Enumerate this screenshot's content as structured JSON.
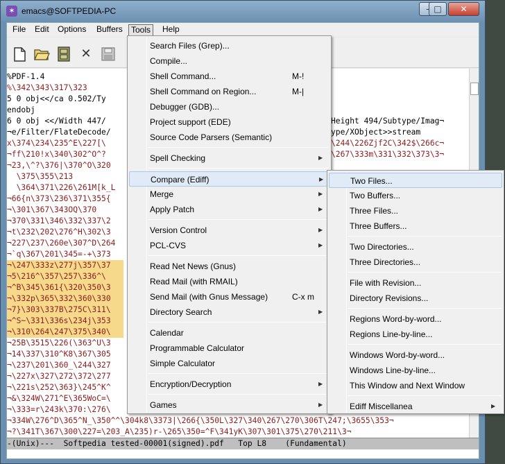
{
  "window": {
    "title": "emacs@SOFTPEDIA-PC",
    "icon": "emacs-gnu-icon",
    "controls": {
      "minimize": "–",
      "maximize": "□",
      "close": "✕"
    }
  },
  "menubar": [
    "File",
    "Edit",
    "Options",
    "Buffers",
    "Tools",
    "Help"
  ],
  "active_menu": "Tools",
  "toolbar": [
    "new-file-icon",
    "open-folder-icon",
    "dired-cabinet-icon",
    "close-buffer-icon",
    "save-icon"
  ],
  "editor": {
    "lines": [
      {
        "text": "%PDF-1.4",
        "style": "black"
      },
      {
        "text": "%\\342\\343\\317\\323",
        "style": "red"
      },
      {
        "text": "5 0 obj<</ca 0.502/Ty",
        "style": "black"
      },
      {
        "text": "endobj",
        "style": "black"
      },
      {
        "text": "6 0 obj <</Width 447/",
        "style": "black",
        "right": "Height 494/Subtype/Imag¬"
      },
      {
        "text": "¬e/Filter/FlateDecode/",
        "style": "black",
        "right": "ype/XObject>>stream"
      },
      {
        "text": "x\\374\\234\\235^E\\227[\\",
        "style": "red",
        "right": "\\244\\226Zjf2C\\342$\\266c¬"
      },
      {
        "text": "¬ff\\210!x\\340\\302^O^?",
        "style": "red",
        "right": "\\267\\333m\\331\\332\\373\\3¬"
      },
      {
        "text": "¬23,\\^?\\376|\\370^O\\320",
        "style": "red"
      },
      {
        "text": "  \\375\\355\\213",
        "style": "red"
      },
      {
        "text": "  \\364\\371\\226\\261M[k_L",
        "style": "red"
      },
      {
        "text": "¬66{n\\373\\236\\371\\355{",
        "style": "red"
      },
      {
        "text": "¬\\301\\367\\343OQ\\370",
        "style": "red"
      },
      {
        "text": "¬370\\331\\346\\332\\337\\2",
        "style": "red"
      },
      {
        "text": "¬t\\232\\202\\276^H\\302\\3",
        "style": "red"
      },
      {
        "text": "¬227\\237\\260e\\307^D\\264",
        "style": "red"
      },
      {
        "text": "¬`q\\367\\201\\345=-+\\373",
        "style": "red"
      },
      {
        "text": "¬\\247\\333z\\277j\\357\\37",
        "style": "hl"
      },
      {
        "text": "¬5\\216^\\357\\257\\336^\\",
        "style": "hl"
      },
      {
        "text": "¬^B\\345\\361{\\320\\350\\3",
        "style": "hl"
      },
      {
        "text": "¬\\332p\\365\\332\\360\\330",
        "style": "hl"
      },
      {
        "text": "¬7}\\303\\337B\\275C\\311\\",
        "style": "hl"
      },
      {
        "text": "¬^S~\\331\\336s\\234j\\353",
        "style": "hl"
      },
      {
        "text": "¬\\310\\264\\247\\375\\340\\",
        "style": "hl"
      },
      {
        "text": "¬25B\\3515\\226(\\363^U\\3",
        "style": "red"
      },
      {
        "text": "¬14\\337\\310^K8\\367\\305",
        "style": "red"
      },
      {
        "text": "¬\\237\\201\\360_\\244\\327",
        "style": "red"
      },
      {
        "text": "¬\\227x\\327\\272\\372\\277",
        "style": "red"
      },
      {
        "text": "¬\\221s\\252\\363}\\245^K^",
        "style": "red"
      },
      {
        "text": "¬&\\324W\\271^E\\365WoC=\\",
        "style": "red"
      },
      {
        "text": "¬\\333=r\\243k\\370:\\276\\",
        "style": "red"
      },
      {
        "text": "¬334W\\276^D\\365^N_\\350^^\\304k8\\3373|\\266{\\350L\\327\\340\\267\\270\\306T\\247;\\3655\\353¬",
        "style": "red"
      },
      {
        "text": "¬?\\341T\\367\\300\\227=\\203_A\\235)r-\\265\\350=^F\\341yK\\307\\301\\375\\270\\211\\3¬",
        "style": "red"
      }
    ]
  },
  "modeline": "-(Unix)---  Softpedia tested-00001(signed).pdf   Top L8    (Fundamental)",
  "tools_menu": [
    {
      "label": "Search Files (Grep)...",
      "shortcut": "",
      "submenu": false
    },
    {
      "label": "Compile...",
      "shortcut": "",
      "submenu": false
    },
    {
      "label": "Shell Command...",
      "shortcut": "M-!",
      "submenu": false
    },
    {
      "label": "Shell Command on Region...",
      "shortcut": "M-|",
      "submenu": false
    },
    {
      "label": "Debugger (GDB)...",
      "shortcut": "",
      "submenu": false
    },
    {
      "label": "Project support (EDE)",
      "shortcut": "",
      "submenu": false
    },
    {
      "label": "Source Code Parsers (Semantic)",
      "shortcut": "",
      "submenu": false
    },
    {
      "sep": true
    },
    {
      "label": "Spell Checking",
      "shortcut": "",
      "submenu": true
    },
    {
      "sep": true
    },
    {
      "label": "Compare (Ediff)",
      "shortcut": "",
      "submenu": true,
      "active": true
    },
    {
      "label": "Merge",
      "shortcut": "",
      "submenu": true
    },
    {
      "label": "Apply Patch",
      "shortcut": "",
      "submenu": true
    },
    {
      "sep": true
    },
    {
      "label": "Version Control",
      "shortcut": "",
      "submenu": true
    },
    {
      "label": "PCL-CVS",
      "shortcut": "",
      "submenu": true
    },
    {
      "sep": true
    },
    {
      "label": "Read Net News (Gnus)",
      "shortcut": "",
      "submenu": false
    },
    {
      "label": "Read Mail (with RMAIL)",
      "shortcut": "",
      "submenu": false
    },
    {
      "label": "Send Mail (with Gnus Message)",
      "shortcut": "C-x m",
      "submenu": false
    },
    {
      "label": "Directory Search",
      "shortcut": "",
      "submenu": true
    },
    {
      "sep": true
    },
    {
      "label": "Calendar",
      "shortcut": "",
      "submenu": false
    },
    {
      "label": "Programmable Calculator",
      "shortcut": "",
      "submenu": false
    },
    {
      "label": "Simple Calculator",
      "shortcut": "",
      "submenu": false
    },
    {
      "sep": true
    },
    {
      "label": "Encryption/Decryption",
      "shortcut": "",
      "submenu": true
    },
    {
      "sep": true
    },
    {
      "label": "Games",
      "shortcut": "",
      "submenu": true
    }
  ],
  "compare_menu": [
    {
      "label": "Two Files...",
      "submenu": false,
      "active": true
    },
    {
      "label": "Two Buffers...",
      "submenu": false
    },
    {
      "label": "Three Files...",
      "submenu": false
    },
    {
      "label": "Three Buffers...",
      "submenu": false
    },
    {
      "sep": true
    },
    {
      "label": "Two Directories...",
      "submenu": false
    },
    {
      "label": "Three Directories...",
      "submenu": false
    },
    {
      "sep": true
    },
    {
      "label": "File with Revision...",
      "submenu": false
    },
    {
      "label": "Directory Revisions...",
      "submenu": false
    },
    {
      "sep": true
    },
    {
      "label": "Regions Word-by-word...",
      "submenu": false
    },
    {
      "label": "Regions Line-by-line...",
      "submenu": false
    },
    {
      "sep": true
    },
    {
      "label": "Windows Word-by-word...",
      "submenu": false
    },
    {
      "label": "Windows Line-by-line...",
      "submenu": false
    },
    {
      "label": "This Window and Next Window",
      "submenu": false
    },
    {
      "sep": true
    },
    {
      "label": "Ediff Miscellanea",
      "submenu": true
    }
  ],
  "colors": {
    "menu_highlight": "#e0ebf7",
    "region_highlight": "#f6d98a",
    "text_red": "#8b1a1a"
  }
}
